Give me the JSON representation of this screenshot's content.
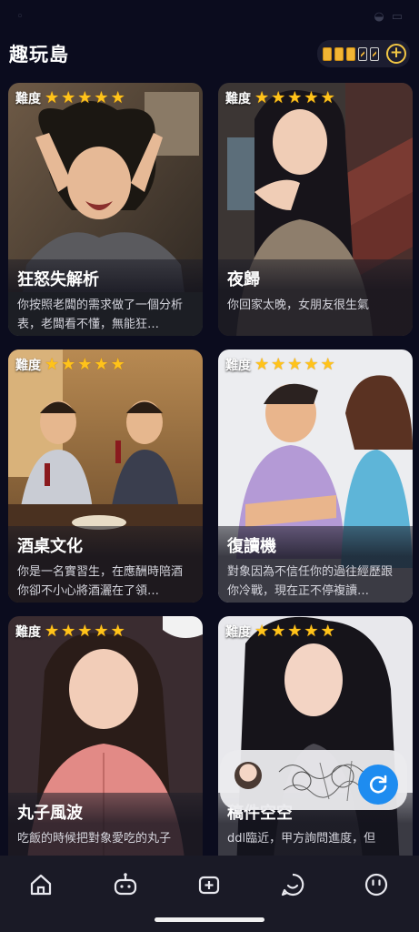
{
  "app": {
    "title": "趣玩島"
  },
  "energy": {
    "full_cells": 3,
    "charging_cells": 2,
    "add_icon": "plus-circle-icon",
    "accent": "#f2c744"
  },
  "difficulty_label": "難度",
  "cards": [
    {
      "title": "狂怒失解析",
      "desc": "你按照老闆的需求做了一個分析表，老闆看不懂，無能狂…",
      "stars": 5
    },
    {
      "title": "夜歸",
      "desc": "你回家太晚，女朋友很生氣",
      "stars": 5
    },
    {
      "title": "酒桌文化",
      "desc": "你是一名實習生，在應酬時陪酒你卻不小心將酒灑在了領…",
      "stars": 5
    },
    {
      "title": "復讀機",
      "desc": "對象因為不信任你的過往經歷跟你冷戰，現在正不停複讀…",
      "stars": 5
    },
    {
      "title": "丸子風波",
      "desc": "吃飯的時候把對象愛吃的丸子",
      "stars": 5
    },
    {
      "title": "稿件空空",
      "desc": "ddl臨近，甲方詢問進度，但",
      "stars": 5
    }
  ],
  "nav": [
    {
      "name": "home",
      "icon": "home-icon"
    },
    {
      "name": "game",
      "icon": "gamepad-icon"
    },
    {
      "name": "create",
      "icon": "add-square-icon"
    },
    {
      "name": "chat",
      "icon": "chat-bubble-icon"
    },
    {
      "name": "profile",
      "icon": "smiley-face-icon"
    }
  ],
  "colors": {
    "background": "#0b0c1e",
    "star": "#ffc31a",
    "refresh": "#1e8cf0",
    "nav_bg": "#1a1a26"
  }
}
